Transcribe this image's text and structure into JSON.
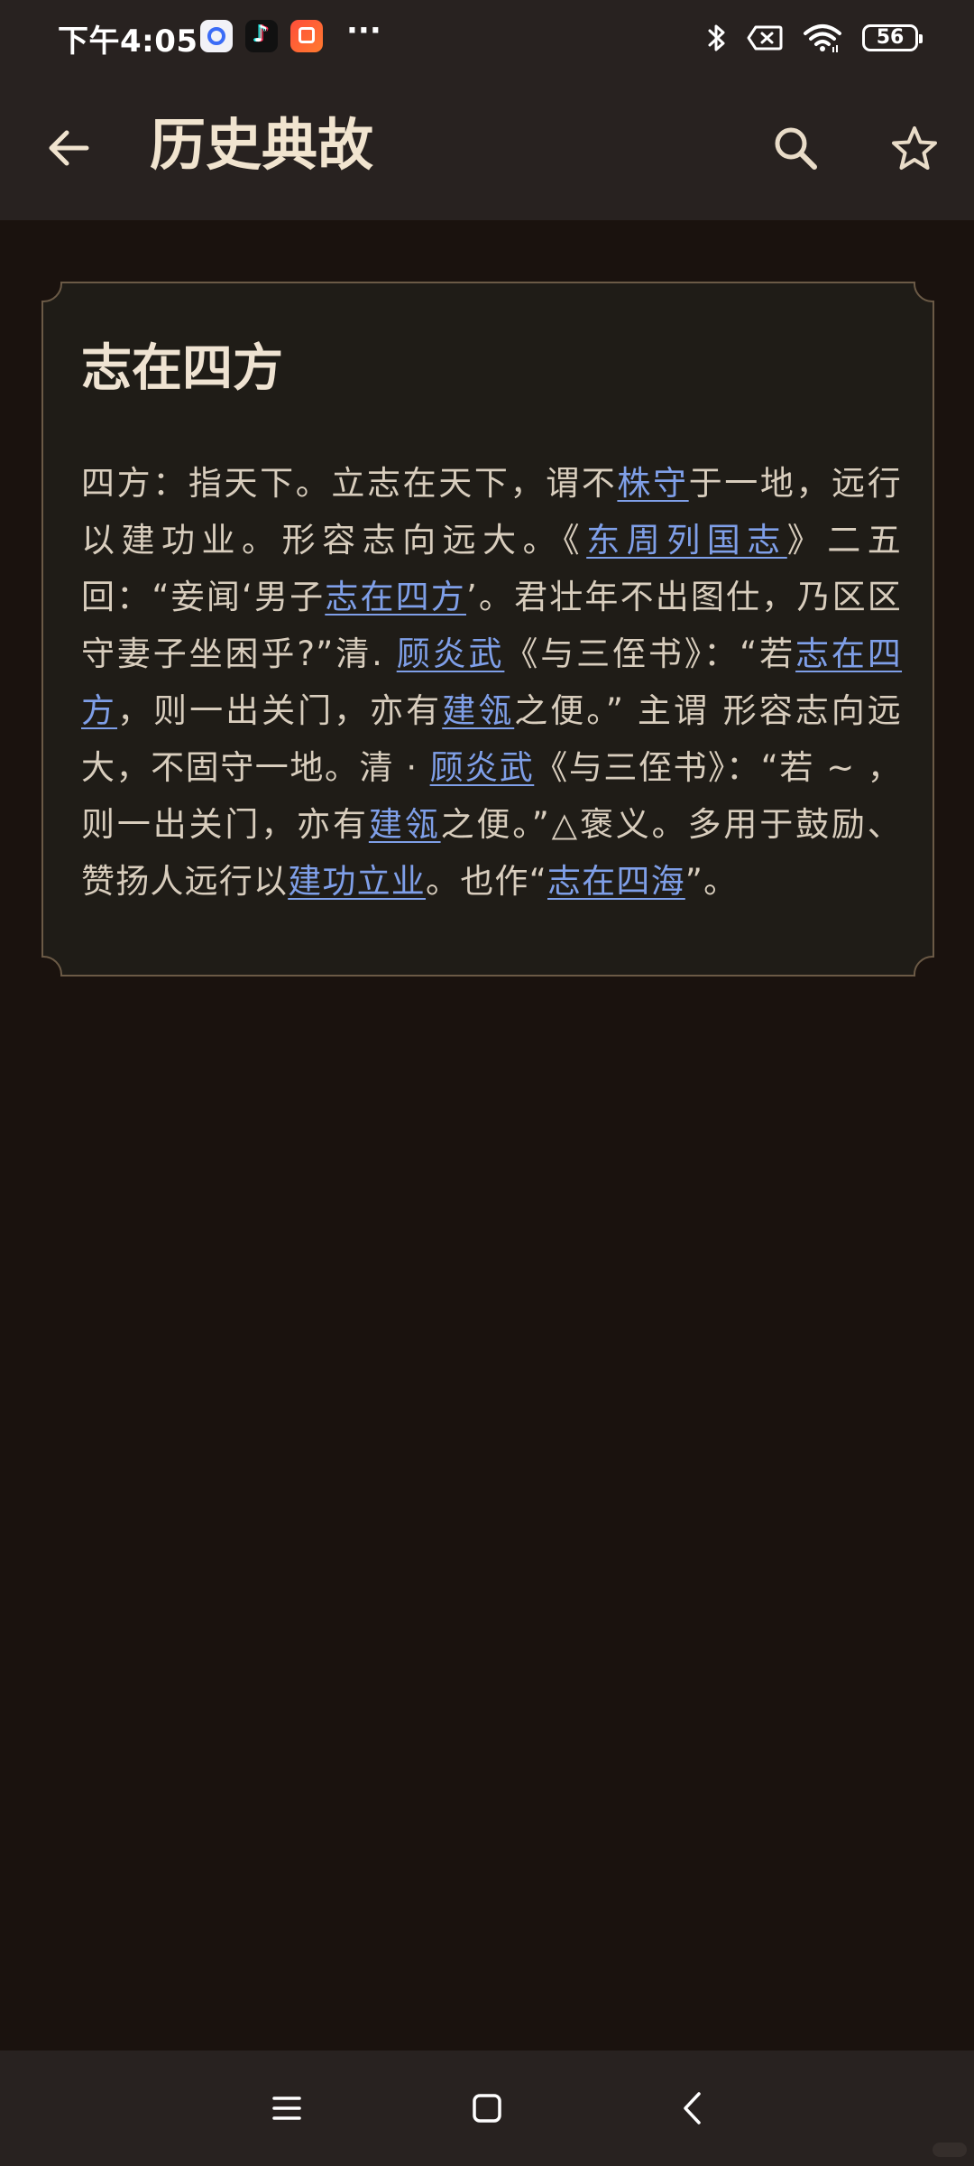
{
  "status_bar": {
    "time": "下午4:05",
    "more": "···",
    "battery": "56",
    "app_icons": [
      "baidu-netdisk-icon",
      "douyin-icon",
      "shopping-app-icon"
    ],
    "system_icons": [
      "bluetooth-icon",
      "no-sim-icon",
      "wifi-icon",
      "battery-icon"
    ]
  },
  "app_bar": {
    "title": "历史典故",
    "icons": [
      "back-arrow-icon",
      "search-icon",
      "star-icon"
    ]
  },
  "entry": {
    "title": "志在四方",
    "segments": [
      {
        "text": "四方：指天下。立志在天下，谓不"
      },
      {
        "text": "株守",
        "link": true
      },
      {
        "text": "于一地，远行以建功业。形容志向远大。《"
      },
      {
        "text": "东周列国志",
        "link": true
      },
      {
        "text": "》二五回：“妾闻‘男子"
      },
      {
        "text": "志在四方",
        "link": true
      },
      {
        "text": "’。君壮年不出图仕，乃区区守妻子坐困乎?”清. "
      },
      {
        "text": "顾炎武",
        "link": true
      },
      {
        "text": "《与三侄书》：“若"
      },
      {
        "text": "志在四方",
        "link": true
      },
      {
        "text": "，则一出关门，亦有"
      },
      {
        "text": "建瓴",
        "link": true
      },
      {
        "text": "之便。” 主谓 形容志向远大，不固守一地。清 · "
      },
      {
        "text": "顾炎武",
        "link": true
      },
      {
        "text": "《与三侄书》：“若 ~ ，则一出关门，亦有"
      },
      {
        "text": "建瓴",
        "link": true
      },
      {
        "text": "之便。”△褒义。多用于鼓励、赞扬人远行以"
      },
      {
        "text": "建功立业",
        "link": true
      },
      {
        "text": "。也作“"
      },
      {
        "text": "志在四海",
        "link": true
      },
      {
        "text": "”。"
      }
    ]
  },
  "nav_bar": {
    "icons": [
      "menu-icon",
      "home-icon",
      "back-icon"
    ]
  },
  "colors": {
    "background": "#1a120e",
    "bar": "#282220",
    "card": "#1f1c17",
    "card_border": "#6b5a46",
    "title_text": "#f1e4cf",
    "body_text": "#d8cdbd",
    "link": "#7f9fe8"
  }
}
